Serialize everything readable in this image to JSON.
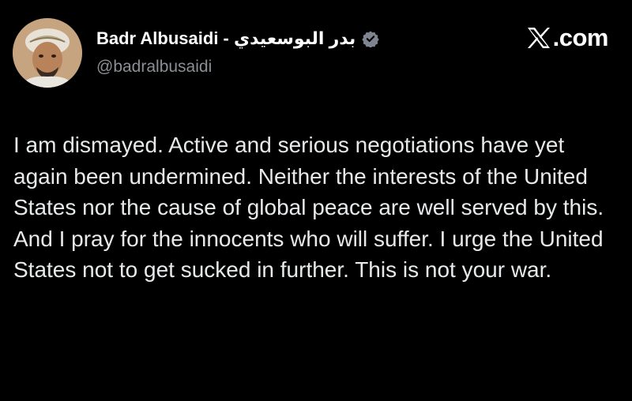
{
  "post": {
    "author_name": "Badr Albusaidi - بدر البوسعيدي",
    "handle": "@badralbusaidi",
    "brand": ".com",
    "text": "I am dismayed. Active and serious negotiations have yet again been undermined. Neither the interests of the United States nor the cause of global peace are well served by this. And I pray for the innocents who will suffer. I urge the United States not to get sucked in further. This is not your war."
  },
  "icons": {
    "verified": "verified-badge-icon",
    "brand_logo": "x-logo-icon"
  },
  "colors": {
    "background": "#000000",
    "text": "#e7e9ea",
    "handle": "#8b8f94",
    "verified_badge": "#7e8590"
  }
}
